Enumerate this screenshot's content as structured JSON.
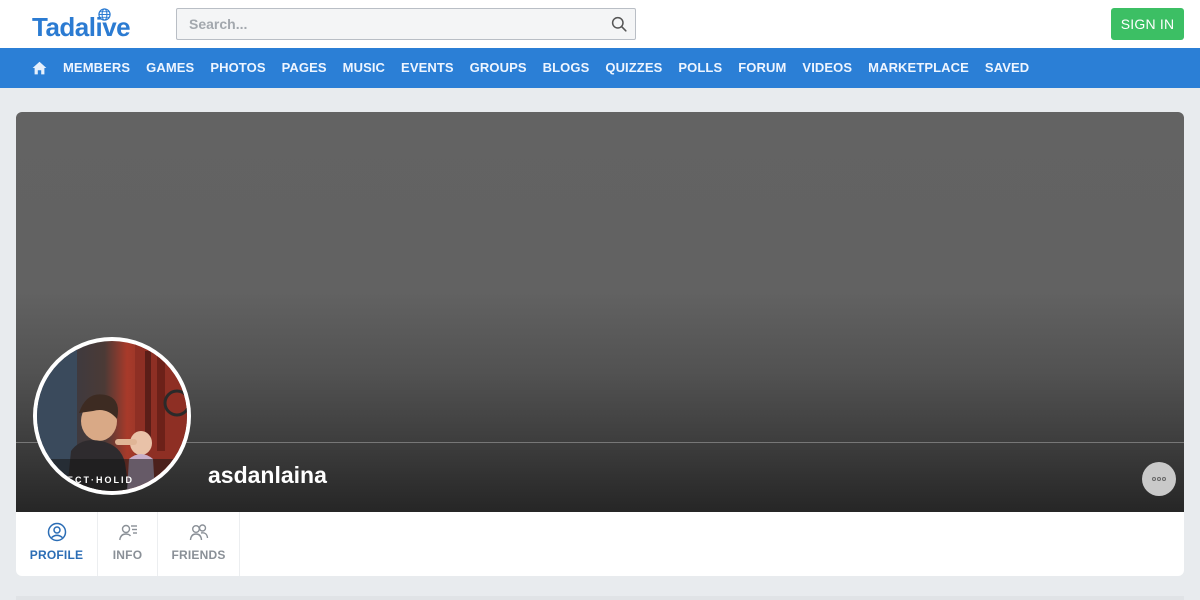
{
  "header": {
    "logo_text": "Tadalive",
    "search_placeholder": "Search...",
    "signin_label": "SIGN IN"
  },
  "nav": {
    "items": [
      {
        "label": "MEMBERS"
      },
      {
        "label": "GAMES"
      },
      {
        "label": "PHOTOS"
      },
      {
        "label": "PAGES"
      },
      {
        "label": "MUSIC"
      },
      {
        "label": "EVENTS"
      },
      {
        "label": "GROUPS"
      },
      {
        "label": "BLOGS"
      },
      {
        "label": "QUIZZES"
      },
      {
        "label": "POLLS"
      },
      {
        "label": "FORUM"
      },
      {
        "label": "VIDEOS"
      },
      {
        "label": "MARKETPLACE"
      },
      {
        "label": "SAVED"
      }
    ]
  },
  "profile": {
    "username": "asdanlaina",
    "avatar_caption": "ECT·HOLID",
    "tabs": [
      {
        "label": "PROFILE",
        "icon": "user-circle-icon",
        "active": true
      },
      {
        "label": "INFO",
        "icon": "user-info-icon",
        "active": false
      },
      {
        "label": "FRIENDS",
        "icon": "friends-icon",
        "active": false
      }
    ]
  },
  "colors": {
    "brand": "#2b7bd2",
    "nav_bg": "#2b7fd6",
    "signin_bg": "#3cbf64",
    "active_tab": "#2b6db5"
  }
}
